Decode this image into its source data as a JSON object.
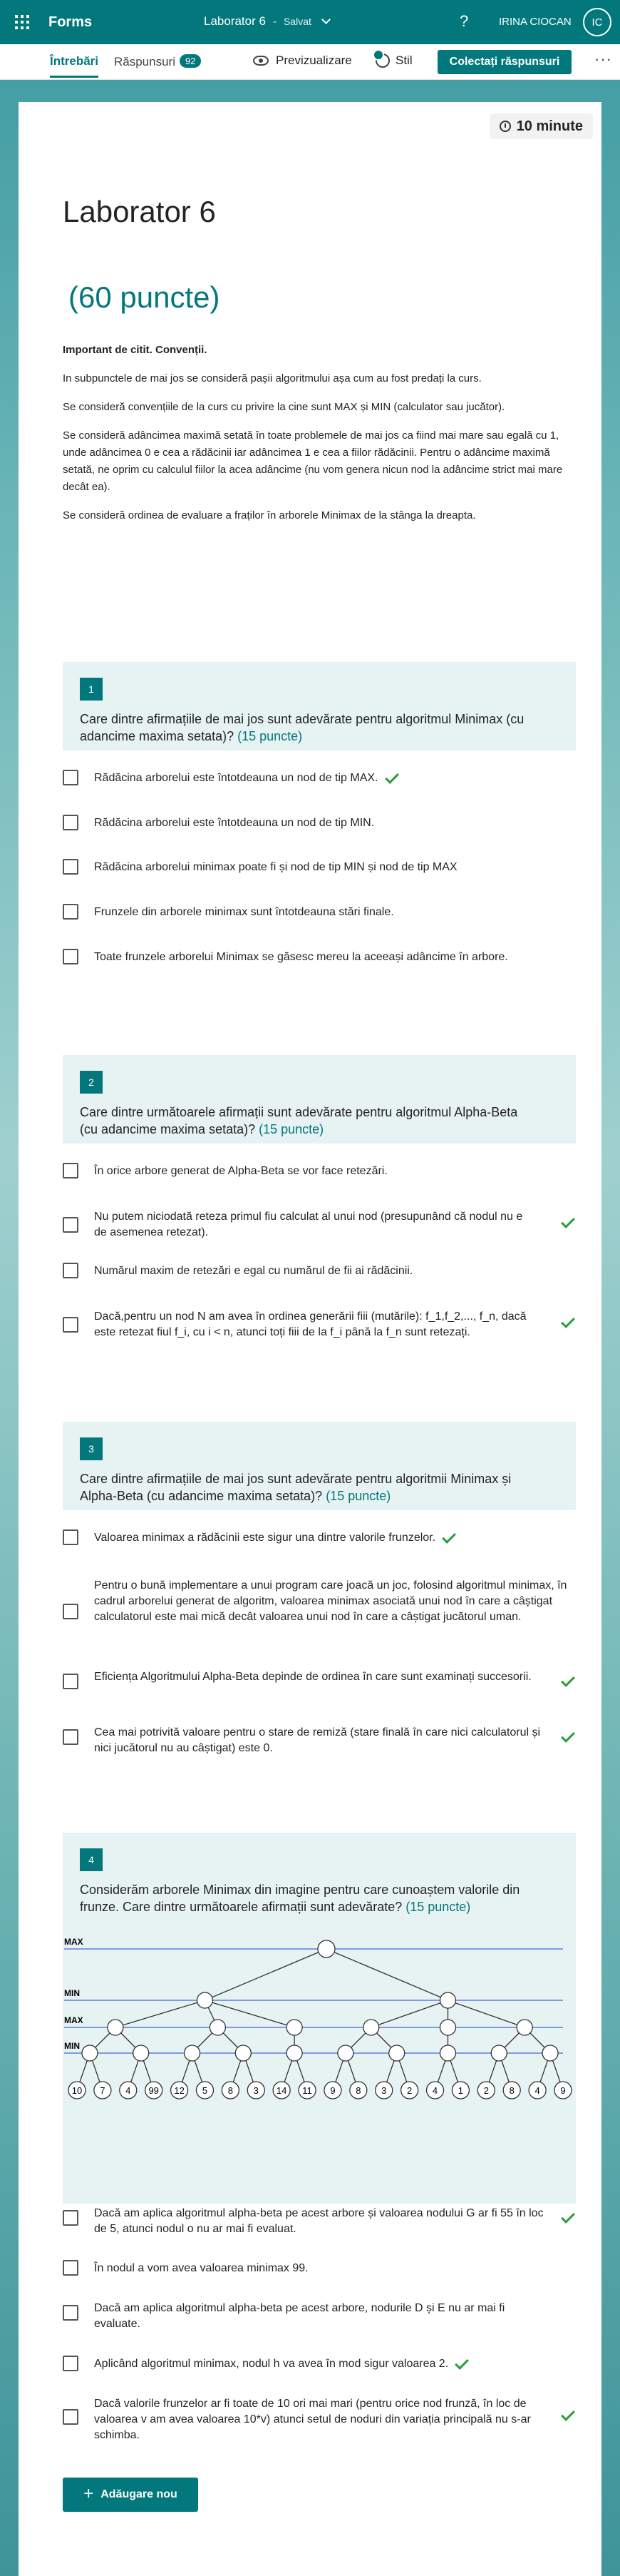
{
  "app": {
    "name": "Forms",
    "doc_title": "Laborator 6",
    "separator": "-",
    "save_status": "Salvat",
    "help": "?",
    "user_name": "IRINA CIOCAN",
    "user_initials": "IC"
  },
  "commands": {
    "tab_questions": "Întrebări",
    "tab_responses": "Răspunsuri",
    "responses_count": "92",
    "preview": "Previzualizare",
    "style": "Stil",
    "collect": "Colectați răspunsuri",
    "more": "···"
  },
  "form": {
    "timer": "10 minute",
    "title": "Laborator 6",
    "points": "(60 puncte)",
    "intro": {
      "heading": "Important de citit. Convenții.",
      "p1": "In subpunctele de mai jos se consideră pașii algoritmului așa cum au fost predați la curs.",
      "p2": "Se consideră convențiile de la curs cu privire la cine sunt MAX și MIN (calculator sau jucător).",
      "p3": "Se  consideră adâncimea maximă setată în toate problemele de mai jos ca  fiind mai mare sau egală cu 1, unde adâncimea 0 e cea a rădăcinii iar  adâncimea 1 e cea a fiilor rădăcinii. Pentru o adâncime maximă setată,  ne oprim cu calculul fiilor la acea adâncime (nu vom genera nicun nod la  adâncime strict mai mare decât ea).",
      "p4": "Se consideră ordinea de evaluare a fraților în arborele Minimax de la stânga la dreapta."
    }
  },
  "questions": [
    {
      "number": "1",
      "text": "Care dintre afirmațiile de mai jos sunt adevărate pentru algoritmul Minimax (cu adancime maxima setata)?",
      "points": "(15 puncte)",
      "options": [
        {
          "text": "Rădăcina arborelui este întotdeauna un nod de tip MAX.",
          "correct": true
        },
        {
          "text": "Rădăcina arborelui este întotdeauna un nod de tip MIN.",
          "correct": false
        },
        {
          "text": "Rădăcina arborelui minimax poate fi și nod de tip MIN și nod de tip MAX",
          "correct": false
        },
        {
          "text": "Frunzele din arborele minimax sunt întotdeauna stări finale.",
          "correct": false
        },
        {
          "text": "Toate frunzele arborelui Minimax se găsesc mereu la aceeași adâncime în arbore.",
          "correct": false
        }
      ]
    },
    {
      "number": "2",
      "text": "Care dintre următoarele afirmații sunt adevărate pentru algoritmul Alpha-Beta (cu adancime maxima setata)?",
      "points": "(15 puncte)",
      "options": [
        {
          "text": "În orice arbore generat de Alpha-Beta se vor face retezări.",
          "correct": false
        },
        {
          "text": "Nu putem niciodată reteza primul fiu calculat al unui nod (presupunând că nodul nu e de asemenea retezat).",
          "correct": true
        },
        {
          "text": "Numărul maxim de retezări e egal cu numărul de fii ai rădăcinii.",
          "correct": false
        },
        {
          "text": "Dacă,pentru un nod N am avea în ordinea generării fiii (mutările): f_1,f_2,..., f_n, dacă este retezat fiul f_i, cu i < n, atunci toți fiii de la f_i până la f_n sunt retezați.",
          "correct": true
        }
      ]
    },
    {
      "number": "3",
      "text": "Care dintre afirmațiile de mai jos sunt adevărate pentru algoritmii Minimax și Alpha-Beta (cu adancime maxima setata)?",
      "points": "(15 puncte)",
      "options": [
        {
          "text": "Valoarea minimax a rădăcinii este sigur una dintre valorile frunzelor.",
          "correct": true
        },
        {
          "text": "Pentru o bună implementare a unui program care joacă un joc, folosind algoritmul minimax, în cadrul arborelui generat de algoritm, valoarea minimax asociată unui nod în care a câștigat calculatorul este mai mică decât valoarea unui nod în care a câștigat jucătorul uman.",
          "correct": false
        },
        {
          "text": "Eficiența Algoritmului Alpha-Beta depinde de ordinea în care sunt examinați succesorii.",
          "correct": true
        },
        {
          "text": "Cea mai potrivită valoare pentru o stare de remiză (stare finală în care nici calculatorul și nici jucătorul nu au câștigat) este 0.",
          "correct": true
        }
      ]
    },
    {
      "number": "4",
      "text": "Considerăm arborele Minimax din imagine pentru care cunoaștem valorile din frunze. Care dintre următoarele afirmații sunt adevărate?",
      "points": "(15 puncte)",
      "options": [
        {
          "text": "Dacă am aplica algoritmul alpha-beta pe acest arbore și valoarea nodului G ar fi 55 în loc de 5, atunci nodul o nu ar mai fi evaluat.",
          "correct": true
        },
        {
          "text": "În nodul a vom avea valoarea minimax 99.",
          "correct": false
        },
        {
          "text": "Dacă am aplica algoritmul alpha-beta pe acest arbore, nodurile D și E nu ar mai fi evaluate.",
          "correct": false
        },
        {
          "text": "Aplicând algoritmul minimax, nodul h va avea în mod sigur valoarea 2.",
          "correct": true
        },
        {
          "text": "Dacă valorile frunzelor ar fi toate de 10 ori mai mari (pentru orice nod frunză, în loc de valoarea v am avea valoarea 10*v) atunci setul de noduri din variația principală nu s-ar schimba.",
          "correct": true
        }
      ]
    }
  ],
  "tree": {
    "level_labels": [
      "MAX",
      "MIN",
      "MAX",
      "MIN"
    ],
    "leaves": [
      "10",
      "7",
      "4",
      "99",
      "12",
      "5",
      "8",
      "3",
      "14",
      "11",
      "9",
      "8",
      "3",
      "2",
      "4",
      "1",
      "2",
      "8",
      "4",
      "9"
    ]
  },
  "add_button": {
    "label": "Adăugare nou",
    "icon": "plus-icon"
  },
  "colors": {
    "accent": "#03787c",
    "question_header_bg": "#e7f2f3",
    "correct_tick": "#2a9d3a"
  }
}
